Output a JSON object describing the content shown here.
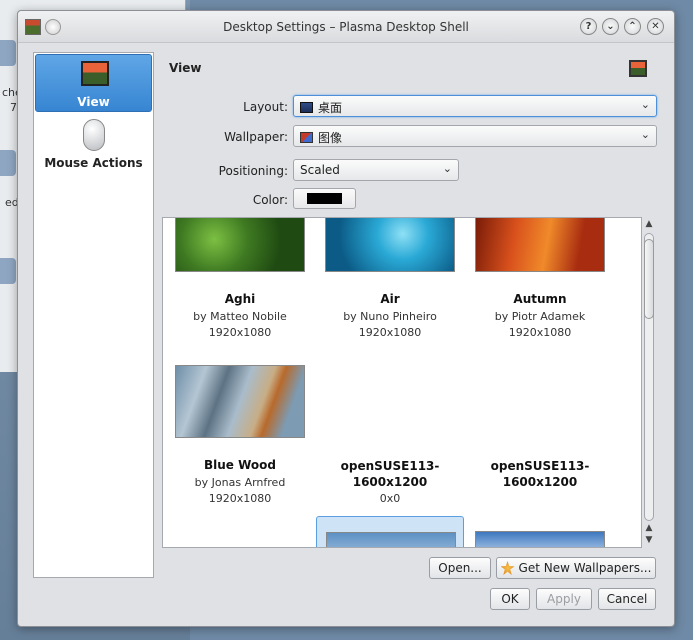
{
  "window": {
    "title": "Desktop Settings – Plasma Desktop Shell"
  },
  "titlebar_buttons": [
    {
      "name": "help",
      "glyph": "?"
    },
    {
      "name": "minimize",
      "glyph": "⌄"
    },
    {
      "name": "maximize",
      "glyph": "⌃"
    },
    {
      "name": "close",
      "glyph": "✕"
    }
  ],
  "background_window": {
    "fragments": [
      "che",
      "7",
      "ed"
    ]
  },
  "pages": [
    {
      "label": "View",
      "icon": "monitor-icon",
      "selected": true
    },
    {
      "label": "Mouse Actions",
      "icon": "mouse-icon",
      "selected": false
    }
  ],
  "view": {
    "header": "View",
    "layout": {
      "label": "Layout:",
      "value": "桌面"
    },
    "wallpaper": {
      "label": "Wallpaper:",
      "value": "图像"
    },
    "positioning": {
      "label": "Positioning:",
      "value": "Scaled"
    },
    "color": {
      "label": "Color:",
      "value": "#000000"
    }
  },
  "wallpapers": [
    {
      "name": "Aghi",
      "author": "by Matteo Nobile",
      "resolution": "1920x1080",
      "thumb_colors": [
        "#1f4a12",
        "#5a9a2a"
      ]
    },
    {
      "name": "Air",
      "author": "by Nuno Pinheiro",
      "resolution": "1920x1080",
      "thumb_colors": [
        "#0b5b86",
        "#2aa9d6"
      ]
    },
    {
      "name": "Autumn",
      "author": "by Piotr Adamek",
      "resolution": "1920x1080",
      "thumb_colors": [
        "#a82c10",
        "#f08a2a"
      ]
    },
    {
      "name": "Blue Wood",
      "author": "by Jonas Arnfred",
      "resolution": "1920x1080",
      "thumb_colors": [
        "#6f8fa8",
        "#c7ad86"
      ]
    },
    {
      "name": "openSUSE113-1600x1200",
      "author": "",
      "resolution": "0x0",
      "thumb_colors": []
    },
    {
      "name": "openSUSE113-1600x1200",
      "author": "",
      "resolution": "",
      "thumb_colors": []
    },
    {
      "name": "",
      "author": "",
      "resolution": "",
      "thumb_colors": [
        "#5d90c4",
        "#a8c6e2"
      ]
    },
    {
      "name": "",
      "author": "",
      "resolution": "",
      "thumb_colors": [
        "#3e78c0",
        "#cfe2f4"
      ]
    }
  ],
  "buttons": {
    "open": "Open...",
    "get_new": "Get New Wallpapers...",
    "ok": "OK",
    "apply": "Apply",
    "cancel": "Cancel"
  }
}
